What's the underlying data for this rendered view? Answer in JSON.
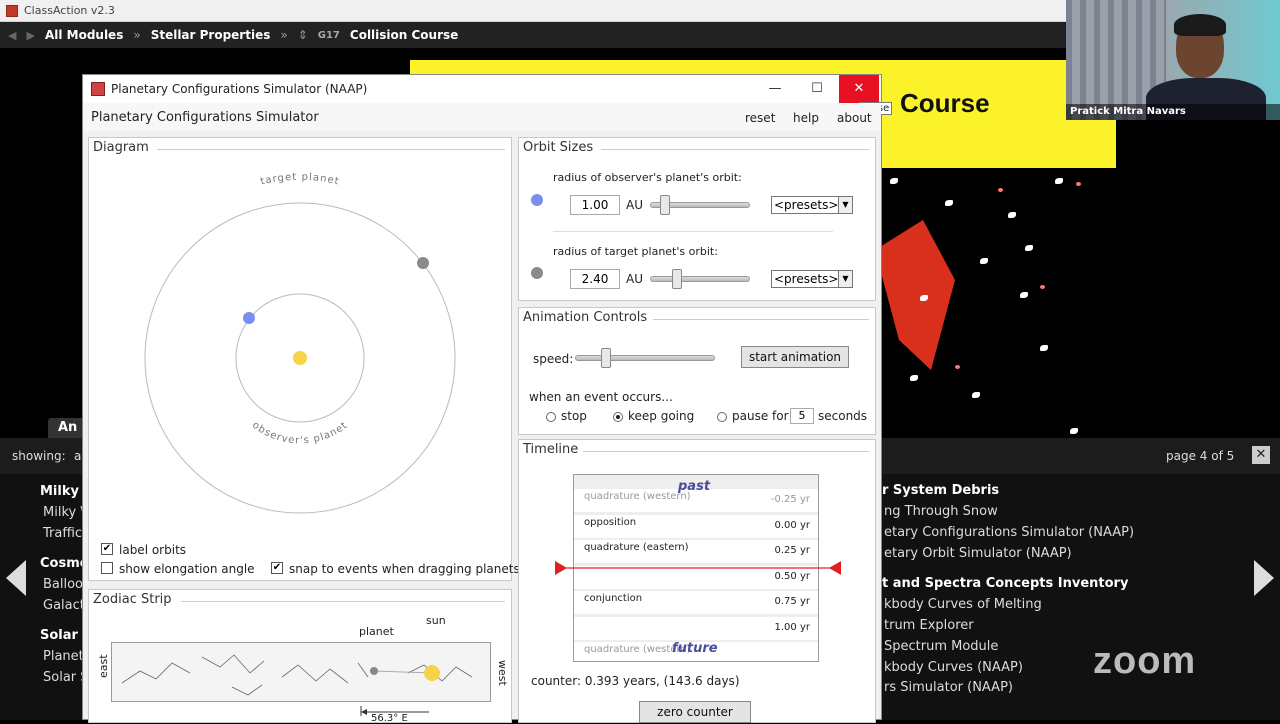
{
  "classaction": {
    "title": "ClassAction v2.3",
    "breadcrumb": [
      "All Modules",
      "Stellar Properties",
      "G17",
      "Collision Course"
    ],
    "banner_text": "Course",
    "tab_label": "An",
    "showing_label": "showing:",
    "showing_value": "a",
    "page_info": "page 4 of 5",
    "close_label": "✕",
    "left_items": [
      {
        "text": "Milky",
        "heading": true
      },
      {
        "text": "Milky \\",
        "heading": false
      },
      {
        "text": "Traffic",
        "heading": false
      },
      {
        "text": "Cosmo",
        "heading": true
      },
      {
        "text": "Balloo",
        "heading": false
      },
      {
        "text": "Galact",
        "heading": false
      },
      {
        "text": "Solar S",
        "heading": true
      },
      {
        "text": "Planet",
        "heading": false
      },
      {
        "text": "Solar S",
        "heading": false
      }
    ],
    "right_items": [
      {
        "text": "r System Debris",
        "heading": true
      },
      {
        "text": "ng Through Snow",
        "heading": false
      },
      {
        "text": "etary Configurations Simulator (NAAP)",
        "heading": false
      },
      {
        "text": "etary Orbit Simulator (NAAP)",
        "heading": false
      },
      {
        "text": "t and Spectra Concepts Inventory",
        "heading": true
      },
      {
        "text": "kbody Curves of Melting",
        "heading": false
      },
      {
        "text": "trum Explorer",
        "heading": false
      },
      {
        "text": "Spectrum Module",
        "heading": false
      },
      {
        "text": "kbody Curves (NAAP)",
        "heading": false
      },
      {
        "text": "rs Simulator (NAAP)",
        "heading": false
      }
    ],
    "zoom_logo": "zoom",
    "webcam_name": "Pratick Mitra Navars"
  },
  "sim": {
    "window_title": "Planetary Configurations Simulator (NAAP)",
    "win_min": "—",
    "win_max": "☐",
    "win_close": "✕",
    "tooltip": "Close",
    "header_title": "Planetary Configurations Simulator",
    "menu": {
      "reset": "reset",
      "help": "help",
      "about": "about"
    },
    "diagram": {
      "title": "Diagram",
      "target_label": "target planet",
      "observer_label": "observer's planet",
      "label_orbits": "label orbits",
      "show_elongation": "show elongation angle",
      "snap_events": "snap to events when dragging planets",
      "label_orbits_checked": true,
      "show_elongation_checked": false,
      "snap_events_checked": true,
      "colors": {
        "observer": "#7b8ef0",
        "target": "#8a8a8a",
        "sun": "#f8d24a"
      }
    },
    "orbit_sizes": {
      "title": "Orbit Sizes",
      "observer_label": "radius of observer's planet's orbit:",
      "observer_value": "1.00",
      "target_label": "radius of target planet's orbit:",
      "target_value": "2.40",
      "unit": "AU",
      "presets": "<presets>"
    },
    "animation": {
      "title": "Animation Controls",
      "speed_label": "speed:",
      "start_button": "start animation",
      "event_label": "when an event occurs...",
      "options": [
        "stop",
        "keep going",
        "pause for"
      ],
      "selected_option": "keep going",
      "pause_seconds": "5",
      "seconds_label": "seconds"
    },
    "timeline": {
      "title": "Timeline",
      "past": "past",
      "future": "future",
      "rows": [
        {
          "event": "quadrature (western)",
          "time": "-0.25 yr",
          "faded": true
        },
        {
          "event": "opposition",
          "time": "0.00 yr",
          "faded": false
        },
        {
          "event": "quadrature (eastern)",
          "time": "0.25 yr",
          "faded": false
        },
        {
          "event": "",
          "time": "0.50 yr",
          "faded": false
        },
        {
          "event": "conjunction",
          "time": "0.75 yr",
          "faded": false
        },
        {
          "event": "",
          "time": "1.00 yr",
          "faded": false
        },
        {
          "event": "quadrature (western)",
          "time": "",
          "faded": true
        }
      ],
      "counter": "counter: 0.393 years, (143.6 days)",
      "zero_button": "zero counter"
    },
    "zodiac": {
      "title": "Zodiac Strip",
      "planet_label": "planet",
      "sun_label": "sun",
      "east": "east",
      "west": "west",
      "elongation": "56.3° E"
    }
  }
}
